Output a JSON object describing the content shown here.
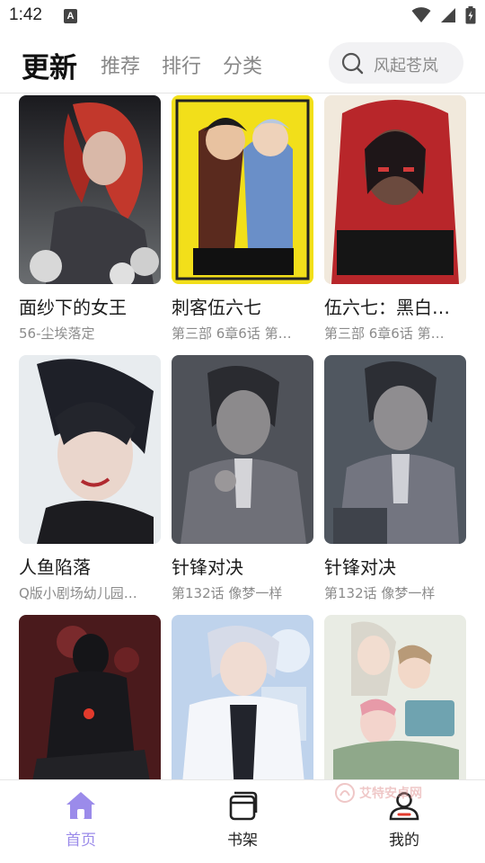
{
  "status_bar": {
    "time": "1:42",
    "notification_glyph": "A"
  },
  "header": {
    "tabs": [
      {
        "label": "更新",
        "active": true
      },
      {
        "label": "推荐",
        "active": false
      },
      {
        "label": "排行",
        "active": false
      },
      {
        "label": "分类",
        "active": false
      }
    ],
    "search_placeholder": "风起苍岚"
  },
  "comics": [
    {
      "title": "面纱下的女王",
      "subtitle": "56-尘埃落定"
    },
    {
      "title": "刺客伍六七",
      "subtitle": "第三部 6章6话 第…"
    },
    {
      "title": "伍六七：黑白…",
      "subtitle": "第三部 6章6话 第…"
    },
    {
      "title": "人鱼陷落",
      "subtitle": "Q版小剧场幼儿园…"
    },
    {
      "title": "针锋对决",
      "subtitle": "第132话 像梦一样"
    },
    {
      "title": "针锋对决",
      "subtitle": "第132话 像梦一样"
    },
    {
      "title": "",
      "subtitle": ""
    },
    {
      "title": "",
      "subtitle": ""
    },
    {
      "title": "",
      "subtitle": ""
    }
  ],
  "watermark": "艾特安卓网",
  "bottom_nav": [
    {
      "label": "首页",
      "icon": "home-icon",
      "active": true
    },
    {
      "label": "书架",
      "icon": "bookshelf-icon",
      "active": false
    },
    {
      "label": "我的",
      "icon": "profile-icon",
      "active": false
    }
  ],
  "colors": {
    "accent": "#9b8bea",
    "inactive_tab": "#888888",
    "subtitle": "#8b8b8b"
  }
}
